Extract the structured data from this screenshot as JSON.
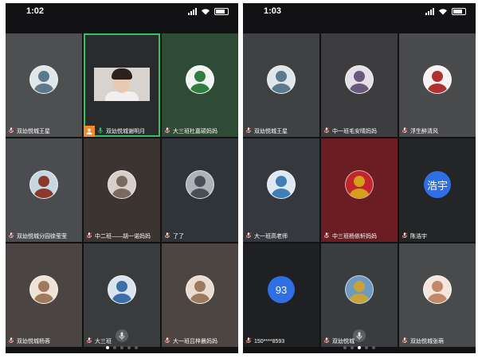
{
  "colors": {
    "active_border": "#35c06a",
    "host_badge": "#f28c28",
    "blue_avatar": "#2f6fe4"
  },
  "left": {
    "time": "1:02",
    "tiles": [
      {
        "name": "双幼悦城王星",
        "bg": "#4d4f50",
        "avatar": {
          "type": "photo",
          "fg": "#5b7a8c",
          "bg": "#dfe7ea"
        }
      },
      {
        "name": "双幼悦城谢明月",
        "bg": "#2a2b2c",
        "active": true,
        "video": true
      },
      {
        "name": "大三班杜嘉硕妈妈",
        "bg": "#2f4a35",
        "avatar": {
          "type": "photo",
          "fg": "#2e7d41",
          "bg": "#f3f5f2"
        }
      },
      {
        "name": "双幼悦城分园徐莹莹",
        "bg": "#4a4c4f",
        "avatar": {
          "type": "photo",
          "fg": "#8a3a2a",
          "bg": "#c8d6e2"
        }
      },
      {
        "name": "中二班——胡一诺妈妈",
        "bg": "#3b3431",
        "avatar": {
          "type": "photo",
          "fg": "#7a6a5f",
          "bg": "#d7cfc8"
        }
      },
      {
        "name": "了了",
        "bg": "#2f3438",
        "avatar": {
          "type": "photo",
          "fg": "#4a4f55",
          "bg": "#aab3ba"
        }
      },
      {
        "name": "双幼悦城杨蓉",
        "bg": "#4a4542",
        "avatar": {
          "type": "photo",
          "fg": "#a07a5e",
          "bg": "#efe3d8"
        }
      },
      {
        "name": "大三班",
        "bg": "#3a3b3d",
        "avatar": {
          "type": "photo",
          "fg": "#3a6fa8",
          "bg": "#d9e4ee"
        }
      },
      {
        "name": "大一班吕梓晨妈妈",
        "bg": "#4c4541",
        "avatar": {
          "type": "photo",
          "fg": "#9c7a60",
          "bg": "#eadcd0"
        }
      }
    ]
  },
  "right": {
    "time": "1:03",
    "tiles": [
      {
        "name": "双幼悦城王星",
        "bg": "#3f4143",
        "avatar": {
          "type": "photo",
          "fg": "#5b7a8c",
          "bg": "#dfe7ea"
        }
      },
      {
        "name": "中一班毛安晴妈妈",
        "bg": "#3d3c3e",
        "avatar": {
          "type": "photo",
          "fg": "#6a5a7a",
          "bg": "#e5e0e8"
        }
      },
      {
        "name": "浮生醉清风",
        "bg": "#4a4b4d",
        "avatar": {
          "type": "photo",
          "fg": "#b03030",
          "bg": "#f7f3f3"
        }
      },
      {
        "name": "大一班高老师",
        "bg": "#35393d",
        "avatar": {
          "type": "photo",
          "fg": "#3f7fb5",
          "bg": "#dfe9f2"
        }
      },
      {
        "name": "中三班杨依轩妈妈",
        "bg": "#6b1d24",
        "avatar": {
          "type": "photo",
          "fg": "#d4a019",
          "bg": "#c0262b"
        }
      },
      {
        "name": "陈浩宇",
        "bg": "#242526",
        "avatar": {
          "type": "text",
          "text": "浩宇",
          "bg": "#2f6fe4"
        }
      },
      {
        "name": "150****8593",
        "bg": "#1f2022",
        "avatar": {
          "type": "text",
          "text": "93",
          "bg": "#2f6fe4"
        }
      },
      {
        "name": "双幼悦城",
        "bg": "#3a3d40",
        "avatar": {
          "type": "photo",
          "fg": "#c9a23a",
          "bg": "#6f9ac0"
        }
      },
      {
        "name": "双幼悦城张萌",
        "bg": "#484a4c",
        "avatar": {
          "type": "photo",
          "fg": "#c08a6a",
          "bg": "#f4e6dc"
        }
      }
    ]
  },
  "pager": {
    "count": 5,
    "left_active": 0,
    "right_active": 2
  }
}
